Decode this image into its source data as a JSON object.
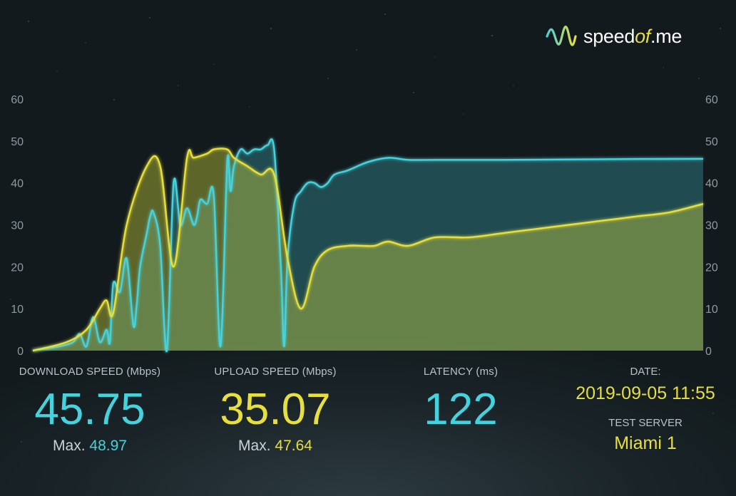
{
  "brand": {
    "name_part1": "speed",
    "name_part2": "of",
    "name_part3": ".me",
    "accent": "#e9df3a"
  },
  "colors": {
    "download": "#46d2dc",
    "upload": "#e6df3c"
  },
  "chart_data": {
    "type": "area",
    "xlabel": "",
    "ylabel": "",
    "ylim": [
      0,
      60
    ],
    "yticks": [
      0,
      10,
      20,
      30,
      40,
      50,
      60
    ],
    "grid": false,
    "series": [
      {
        "name": "DOWNLOAD SPEED",
        "color": "#46d2dc",
        "x": [
          0,
          0.02,
          0.04,
          0.06,
          0.07,
          0.08,
          0.09,
          0.1,
          0.11,
          0.115,
          0.12,
          0.13,
          0.14,
          0.15,
          0.155,
          0.16,
          0.17,
          0.175,
          0.18,
          0.19,
          0.2,
          0.21,
          0.22,
          0.23,
          0.24,
          0.245,
          0.25,
          0.26,
          0.27,
          0.28,
          0.29,
          0.295,
          0.3,
          0.31,
          0.32,
          0.33,
          0.34,
          0.35,
          0.36,
          0.37,
          0.375,
          0.38,
          0.39,
          0.4,
          0.41,
          0.42,
          0.43,
          0.44,
          0.45,
          0.47,
          0.5,
          0.53,
          0.56,
          0.6,
          0.65,
          0.7,
          0.8,
          0.9,
          1.0
        ],
        "y": [
          0,
          0.5,
          1,
          2,
          4,
          1,
          8,
          2,
          5,
          2,
          16,
          14,
          22,
          6,
          11,
          20,
          28,
          32,
          33,
          25,
          0,
          40,
          30,
          34,
          30,
          32,
          36,
          35,
          37,
          1,
          45,
          38,
          44,
          48,
          47,
          48,
          48,
          49,
          48,
          20,
          1,
          22,
          35,
          38,
          40,
          40,
          39,
          40,
          42,
          43,
          45,
          46,
          45.5,
          45.5,
          45.5,
          45.5,
          45.6,
          45.7,
          45.75
        ]
      },
      {
        "name": "UPLOAD SPEED",
        "color": "#e6df3c",
        "x": [
          0,
          0.05,
          0.08,
          0.1,
          0.11,
          0.12,
          0.14,
          0.17,
          0.19,
          0.21,
          0.23,
          0.24,
          0.26,
          0.27,
          0.29,
          0.3,
          0.32,
          0.34,
          0.36,
          0.38,
          0.4,
          0.42,
          0.44,
          0.47,
          0.49,
          0.51,
          0.53,
          0.56,
          0.6,
          0.65,
          0.7,
          0.75,
          0.8,
          0.85,
          0.9,
          0.95,
          1.0
        ],
        "y": [
          0,
          2,
          5,
          10,
          12,
          9,
          30,
          44,
          44,
          20,
          46,
          46,
          47,
          48,
          48,
          46,
          44,
          42,
          42,
          22,
          10,
          20,
          24,
          25,
          25,
          25,
          26,
          25,
          27,
          27,
          28,
          29,
          30,
          31,
          32,
          33,
          35
        ]
      }
    ]
  },
  "stats": {
    "download": {
      "label": "DOWNLOAD SPEED (Mbps)",
      "value": "45.75",
      "max_label": "Max.",
      "max_value": "48.97"
    },
    "upload": {
      "label": "UPLOAD SPEED (Mbps)",
      "value": "35.07",
      "max_label": "Max.",
      "max_value": "47.64"
    },
    "latency": {
      "label": "LATENCY (ms)",
      "value": "122"
    },
    "date": {
      "label": "DATE:",
      "value": "2019-09-05 11:55"
    },
    "server": {
      "label": "TEST SERVER",
      "value": "Miami 1"
    }
  }
}
